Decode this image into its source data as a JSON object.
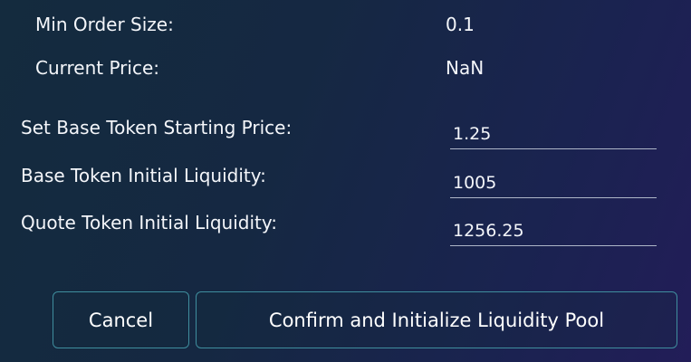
{
  "info": {
    "min_order_size_label": "Min Order Size:",
    "min_order_size_value": "0.1",
    "current_price_label": "Current Price:",
    "current_price_value": "NaN"
  },
  "form": {
    "base_price_label": "Set Base Token Starting Price:",
    "base_price_value": "1.25",
    "base_liquidity_label": "Base Token Initial Liquidity:",
    "base_liquidity_value": "1005",
    "quote_liquidity_label": "Quote Token Initial Liquidity:",
    "quote_liquidity_value": "1256.25"
  },
  "actions": {
    "cancel_label": "Cancel",
    "confirm_label": "Confirm and Initialize Liquidity Pool"
  },
  "colors": {
    "background_start": "#142b3e",
    "background_end": "#221d58",
    "button_border": "#3f8e9e",
    "field_underline": "#aeb6c8",
    "text": "#f4f6fa"
  }
}
